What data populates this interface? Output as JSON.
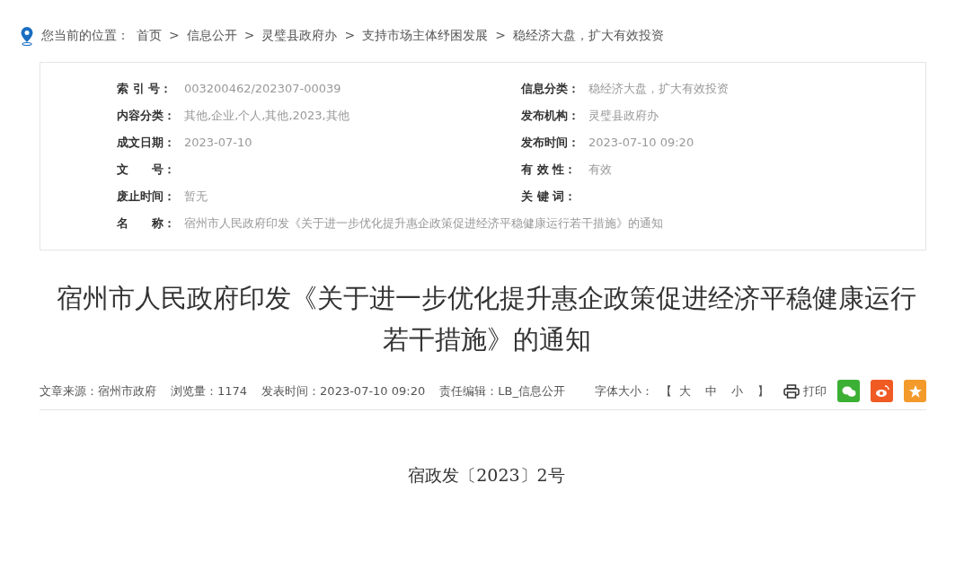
{
  "breadcrumb": {
    "prefix": "您当前的位置：",
    "items": [
      {
        "label": "首页"
      },
      {
        "label": "信息公开"
      },
      {
        "label": "灵璧县政府办"
      },
      {
        "label": "支持市场主体纾困发展"
      },
      {
        "label": "稳经济大盘，扩大有效投资"
      }
    ],
    "separator": ">"
  },
  "meta": {
    "rows": [
      [
        {
          "label": "索 引 号：",
          "value": "003200462/202307-00039"
        },
        {
          "label": "信息分类：",
          "value": "稳经济大盘，扩大有效投资"
        }
      ],
      [
        {
          "label": "内容分类：",
          "value": "其他,企业,个人,其他,2023,其他"
        },
        {
          "label": "发布机构：",
          "value": "灵璧县政府办"
        }
      ],
      [
        {
          "label": "成文日期：",
          "value": "2023-07-10"
        },
        {
          "label": "发布时间：",
          "value": "2023-07-10 09:20"
        }
      ],
      [
        {
          "label": "文　　号："
        },
        {
          "label": "有 效 性：",
          "value": "有效"
        }
      ],
      [
        {
          "label": "废止时间：",
          "value": "暂无"
        },
        {
          "label": "关 键 词："
        }
      ]
    ],
    "name": {
      "label": "名　　称：",
      "value": "宿州市人民政府印发《关于进一步优化提升惠企政策促进经济平稳健康运行若干措施》的通知"
    }
  },
  "title": "宿州市人民政府印发《关于进一步优化提升惠企政策促进经济平稳健康运行若干措施》的通知",
  "info": [
    "文章来源：宿州市政府",
    "浏览量：1174",
    "发表时间：2023-07-10 09:20",
    "责任编辑：LB_信息公开"
  ],
  "font_size": {
    "label": "字体大小：",
    "open": "【",
    "sizes": [
      "大",
      "中",
      "小"
    ],
    "close": "】"
  },
  "print": "打印",
  "share": [
    {
      "kind": "wechat",
      "color": "#3cb034"
    },
    {
      "kind": "weibo",
      "color": "#f05a23"
    },
    {
      "kind": "favorite",
      "color": "#f39a2b"
    }
  ],
  "doc_number": "宿政发〔2023〕2号"
}
